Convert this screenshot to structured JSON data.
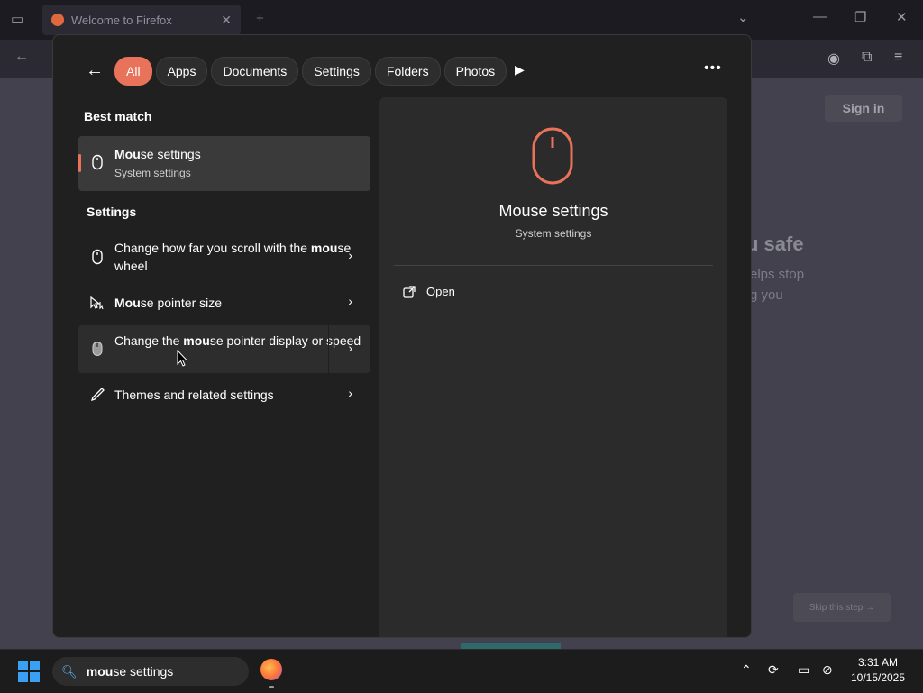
{
  "firefox": {
    "tab_title": "Welcome to Firefox",
    "signin_label": "Sign in",
    "heading_partial": "u safe",
    "text_line1": "elps stop",
    "text_line2": "g you",
    "skip_label": "Skip this step →"
  },
  "search": {
    "filters": [
      "All",
      "Apps",
      "Documents",
      "Settings",
      "Folders",
      "Photos"
    ],
    "active_filter": "All",
    "best_match_label": "Best match",
    "best_match": {
      "name": "Mouse settings",
      "subtitle": "System settings"
    },
    "settings_label": "Settings",
    "results": [
      {
        "text": "Change how far you scroll with the mouse wheel"
      },
      {
        "text": "Mouse pointer size"
      },
      {
        "text": "Change the mouse pointer display or speed"
      },
      {
        "text": "Themes and related settings"
      }
    ],
    "preview": {
      "title": "Mouse settings",
      "subtitle": "System settings",
      "open_label": "Open"
    }
  },
  "taskbar": {
    "search_value": "mouse settings",
    "time": "3:31 AM",
    "date": "10/15/2025"
  },
  "colors": {
    "accent": "#e8735a",
    "windows_blue": "#3aa0f3"
  }
}
